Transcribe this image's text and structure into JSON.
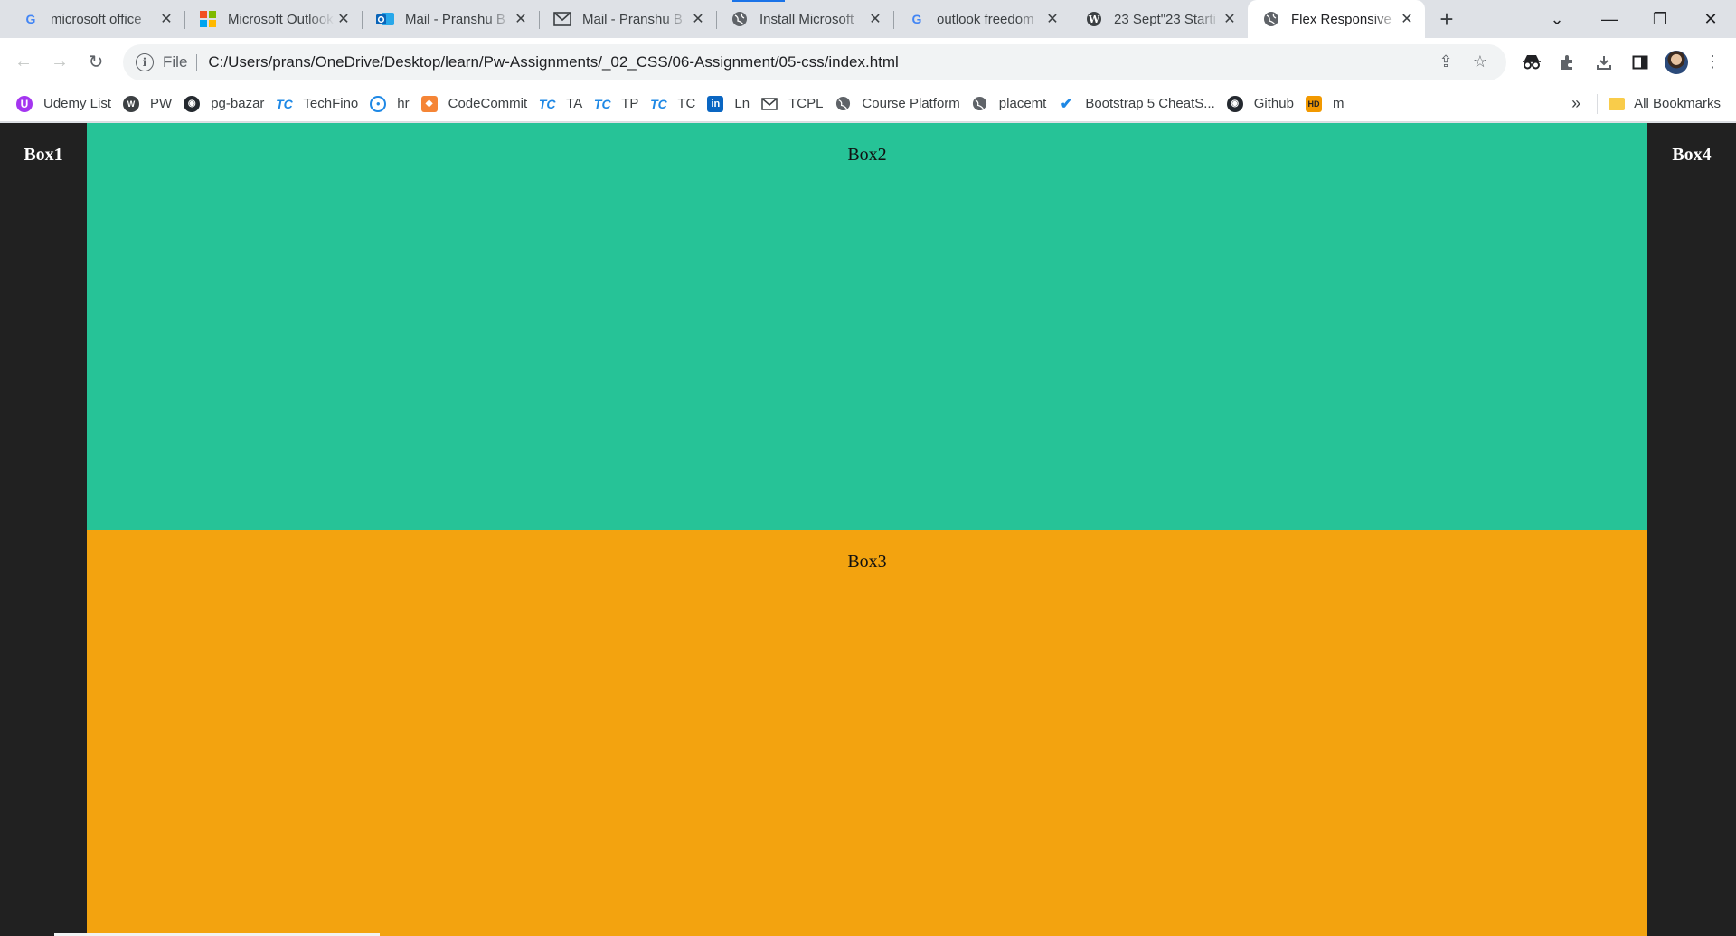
{
  "browser": {
    "tabs": [
      {
        "title": "microsoft office",
        "favicon": "google-icon",
        "active": false
      },
      {
        "title": "Microsoft Outlook",
        "favicon": "microsoft-icon",
        "active": false
      },
      {
        "title": "Mail - Pranshu B",
        "favicon": "outlook-icon",
        "active": false
      },
      {
        "title": "Mail - Pranshu B",
        "favicon": "mail-icon",
        "active": false
      },
      {
        "title": "Install Microsoft",
        "favicon": "globe-icon",
        "active": false
      },
      {
        "title": "outlook freedom",
        "favicon": "google-icon",
        "active": false
      },
      {
        "title": "23 Sept\"23 Starti",
        "favicon": "wordpress-icon",
        "active": false
      },
      {
        "title": "Flex Responsive",
        "favicon": "globe-icon",
        "active": true
      }
    ],
    "address": {
      "scheme": "File",
      "url": "C:/Users/prans/OneDrive/Desktop/learn/Pw-Assignments/_02_CSS/06-Assignment/05-css/index.html"
    },
    "bookmarks": [
      {
        "label": "Udemy List",
        "icon": "udemy-icon"
      },
      {
        "label": "PW",
        "icon": "pw-icon"
      },
      {
        "label": "pg-bazar",
        "icon": "github-icon"
      },
      {
        "label": "TechFino",
        "icon": "tc-icon"
      },
      {
        "label": "hr",
        "icon": "hr-icon"
      },
      {
        "label": "CodeCommit",
        "icon": "aws-icon"
      },
      {
        "label": "TA",
        "icon": "tc-icon"
      },
      {
        "label": "TP",
        "icon": "tc-icon"
      },
      {
        "label": "TC",
        "icon": "tc-icon"
      },
      {
        "label": "Ln",
        "icon": "linkedin-icon"
      },
      {
        "label": "TCPL",
        "icon": "mail-icon"
      },
      {
        "label": "Course Platform",
        "icon": "globe-icon"
      },
      {
        "label": "placemt",
        "icon": "globe-icon"
      },
      {
        "label": "Bootstrap 5 CheatS...",
        "icon": "check-icon"
      },
      {
        "label": "Github",
        "icon": "github-icon"
      },
      {
        "label": "m",
        "icon": "hd-icon"
      }
    ],
    "all_bookmarks_label": "All Bookmarks",
    "more_label": "»"
  },
  "page": {
    "box1": "Box1",
    "box2": "Box2",
    "box3": "Box3",
    "box4": "Box4",
    "colors": {
      "sides": "#212121",
      "box2": "#26c397",
      "box3": "#f3a30f"
    }
  }
}
